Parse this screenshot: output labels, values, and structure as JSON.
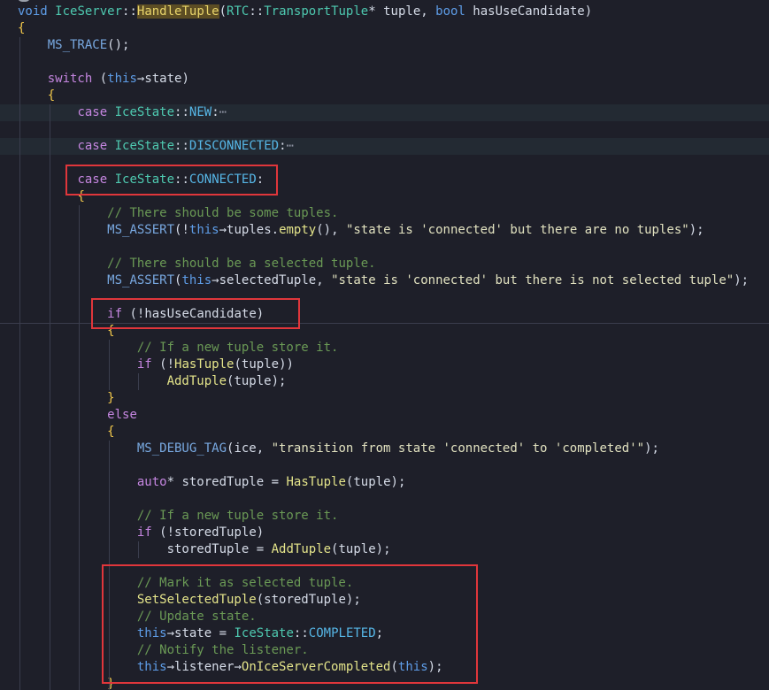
{
  "editor": {
    "language": "cpp",
    "colors": {
      "background": "#1e1f29",
      "keyword": "#c586e0",
      "function": "#e4e48a",
      "comment": "#6a9955",
      "type": "#4ec9b0",
      "highlight_box": "#e0363b"
    },
    "lines": [
      {
        "text": "void IceServer::HandleTuple(RTC::TransportTuple* tuple, bool hasUseCandidate)"
      },
      {
        "text": "{"
      },
      {
        "text": "    MS_TRACE();"
      },
      {
        "text": ""
      },
      {
        "text": "    switch (this→state)"
      },
      {
        "text": "    {"
      },
      {
        "text": "        case IceState::NEW:⋯",
        "folded": true
      },
      {
        "text": ""
      },
      {
        "text": "        case IceState::DISCONNECTED:⋯",
        "folded": true
      },
      {
        "text": ""
      },
      {
        "text": "        case IceState::CONNECTED:"
      },
      {
        "text": "        {"
      },
      {
        "text": "            // There should be some tuples."
      },
      {
        "text": "            MS_ASSERT(!this→tuples.empty(), \"state is 'connected' but there are no tuples\");"
      },
      {
        "text": ""
      },
      {
        "text": "            // There should be a selected tuple."
      },
      {
        "text": "            MS_ASSERT(this→selectedTuple, \"state is 'connected' but there is not selected tuple\");"
      },
      {
        "text": ""
      },
      {
        "text": "            if (!hasUseCandidate)"
      },
      {
        "text": "            {"
      },
      {
        "text": "                // If a new tuple store it."
      },
      {
        "text": "                if (!HasTuple(tuple))"
      },
      {
        "text": "                    AddTuple(tuple);"
      },
      {
        "text": "            }"
      },
      {
        "text": "            else"
      },
      {
        "text": "            {"
      },
      {
        "text": "                MS_DEBUG_TAG(ice, \"transition from state 'connected' to 'completed'\");"
      },
      {
        "text": ""
      },
      {
        "text": "                auto* storedTuple = HasTuple(tuple);"
      },
      {
        "text": ""
      },
      {
        "text": "                // If a new tuple store it."
      },
      {
        "text": "                if (!storedTuple)"
      },
      {
        "text": "                    storedTuple = AddTuple(tuple);"
      },
      {
        "text": ""
      },
      {
        "text": "                // Mark it as selected tuple."
      },
      {
        "text": "                SetSelectedTuple(storedTuple);"
      },
      {
        "text": "                // Update state."
      },
      {
        "text": "                this→state = IceState::COMPLETED;"
      },
      {
        "text": "                // Notify the listener."
      },
      {
        "text": "                this→listener→OnIceServerCompleted(this);"
      },
      {
        "text": "            }"
      }
    ]
  }
}
